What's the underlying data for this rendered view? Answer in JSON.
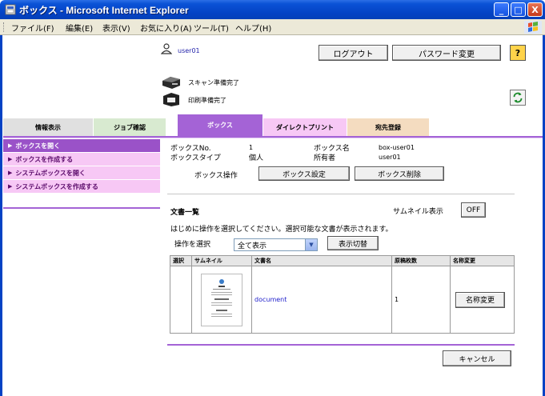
{
  "window": {
    "title": "ボックス - Microsoft Internet Explorer",
    "minimize": "_",
    "maximize": "□",
    "close": "X"
  },
  "menu": [
    "ファイル(F)",
    "編集(E)",
    "表示(V)",
    "お気に入り(A)",
    "ツール(T)",
    "ヘルプ(H)"
  ],
  "header": {
    "user": "user01",
    "logout": "ログアウト",
    "password_change": "パスワード変更",
    "help": "?"
  },
  "status": {
    "scan": "スキャン準備完了",
    "print": "印刷準備完了"
  },
  "tabs": [
    {
      "label": "情報表示",
      "color": "#e0e0e0"
    },
    {
      "label": "ジョブ確認",
      "color": "#d8ead0"
    },
    {
      "label": "ボックス",
      "color": "#a463d6",
      "active": true
    },
    {
      "label": "ダイレクトプリント",
      "color": "#f7c8f5"
    },
    {
      "label": "宛先登録",
      "color": "#f4dcc0"
    }
  ],
  "side_menu": [
    {
      "label": "ボックスを開く",
      "active": true
    },
    {
      "label": "ボックスを作成する"
    },
    {
      "label": "システムボックスを開く"
    },
    {
      "label": "システムボックスを作成する"
    }
  ],
  "box_info": {
    "no_label": "ボックスNo.",
    "no_value": "1",
    "name_label": "ボックス名",
    "name_value": "box-user01",
    "type_label": "ボックスタイプ",
    "type_value": "個人",
    "owner_label": "所有者",
    "owner_value": "user01",
    "ops_label": "ボックス操作",
    "settings_button": "ボックス設定",
    "delete_button": "ボックス削除"
  },
  "doc_list": {
    "title": "文書一覧",
    "thumbnail_label": "サムネイル表示",
    "thumbnail_toggle": "OFF",
    "instruction": "はじめに操作を選択してください。選択可能な文書が表示されます。",
    "operation_label": "操作を選択",
    "operation_value": "全て表示",
    "switch_button": "表示切替",
    "columns": [
      "選択",
      "サムネイル",
      "文書名",
      "原稿枚数",
      "名称変更"
    ],
    "rows": [
      {
        "name": "document",
        "pages": "1",
        "rename": "名称変更"
      }
    ]
  },
  "cancel_button": "キャンセル"
}
